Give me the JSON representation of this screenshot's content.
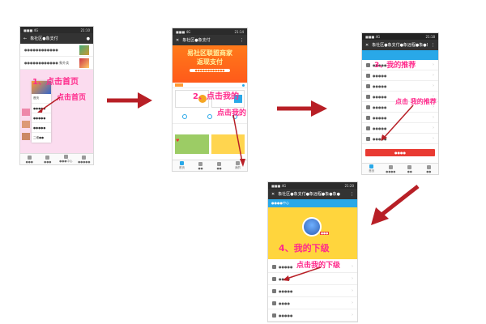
{
  "colors": {
    "accent": "#ff2b8c",
    "arrow": "#b81f26",
    "header_blue": "#29a8e8",
    "orange": "#ff6a1a",
    "red_button": "#e93a32",
    "pink_bg": "#fbdcef",
    "yellow": "#ffd53d"
  },
  "phone1": {
    "status": "■■■ 4G",
    "time": "21:10",
    "title": "象社区●象支付",
    "rows": [
      "●●●●●●●●●●●●",
      "●●●●●●●●●●●● 象外卖",
      "",
      "首页",
      "●●●●●",
      "●●●●●",
      "●●●●●",
      "二维●●"
    ],
    "tabs": [
      "●●●",
      "●●●",
      "●●●中心",
      "●●●●●"
    ],
    "callout1": "1、点击首页",
    "callout2": "点击首页"
  },
  "phone2": {
    "status": "■■■ 4G",
    "time": "21:14",
    "title": "象社区●象支付",
    "banner_line1": "易社区联盟商家",
    "banner_line2": "返现支付",
    "banner_sub": "●●●●●●●●●●●●",
    "callout1": "2、点击我的",
    "callout2": "点击我的",
    "tabs": [
      "首页",
      "●●",
      "●●",
      "我的"
    ]
  },
  "phone3": {
    "status": "■■■ 4G",
    "time": "21:18",
    "title": "象社区●象支付●象远程●象●象●",
    "rows": [
      "●●●●●",
      "●●●●●",
      "●●●●●",
      "●●●●●",
      "●●●●●",
      "●●●●●",
      "●●●●●",
      "●●●●●"
    ],
    "button_label": "●●●●",
    "callout1": "3、我的推荐",
    "callout2": "点击 我的推荐",
    "tabs": [
      "首页",
      "●●●●",
      "●●",
      "●●"
    ]
  },
  "phone4": {
    "status": "■■■ 4G",
    "time": "21:20",
    "title": "象社区●象支付●象远程●象●象●",
    "header_label": "●●●●中心",
    "badge": "●●●",
    "callout1": "4、我的下级",
    "callout2": "点击我的下级",
    "rows": [
      "●●●●●",
      "●●●●",
      "●●●●●",
      "●●●●",
      "●●●●●"
    ]
  }
}
